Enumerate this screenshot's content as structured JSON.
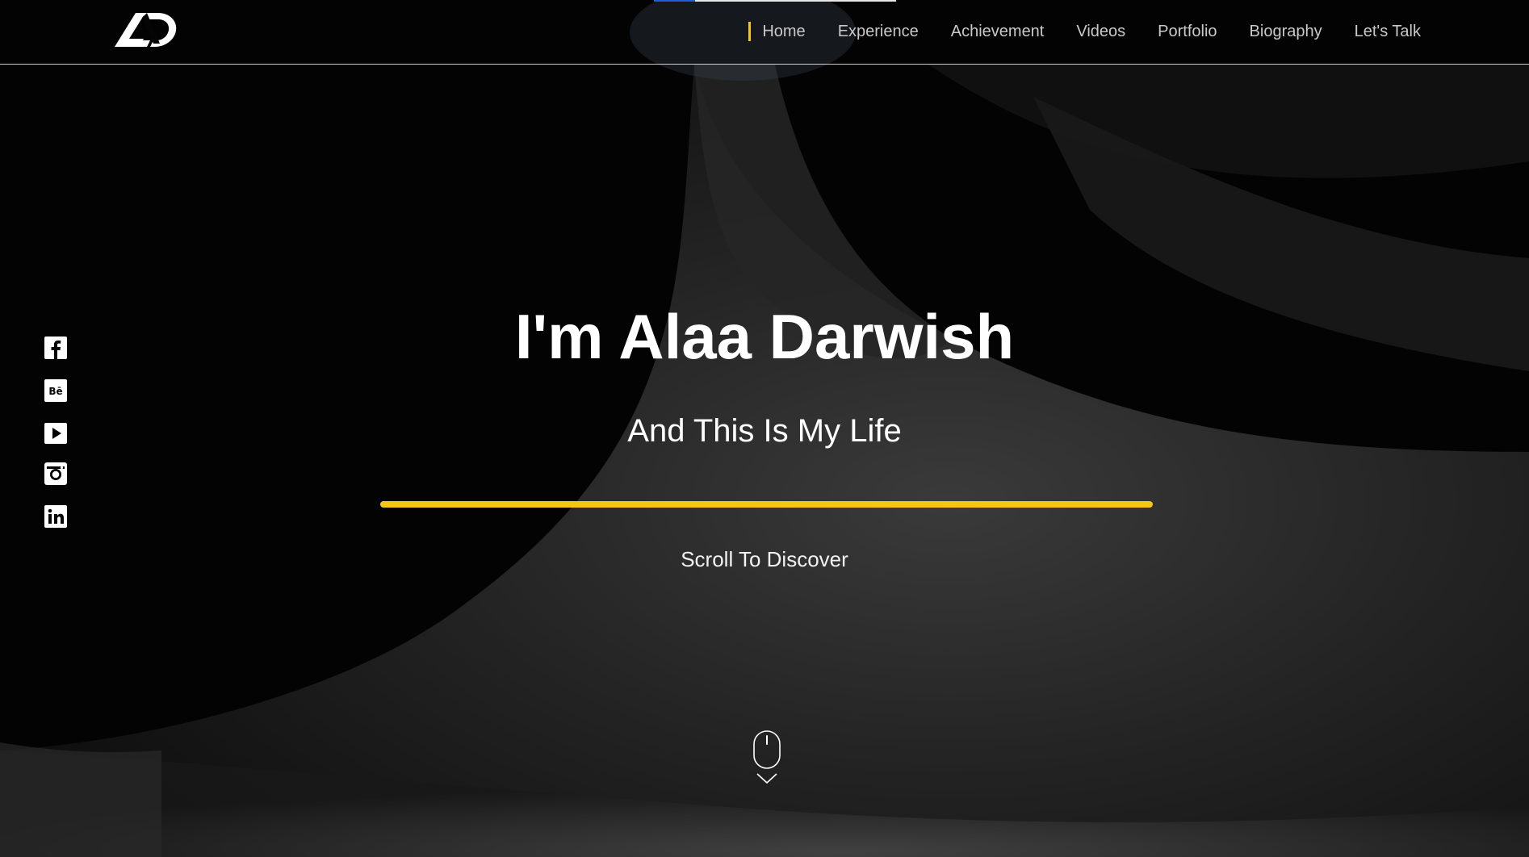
{
  "header": {
    "logo": {
      "icon": "ad-monogram-logo",
      "color": "#ffffff"
    },
    "scroll_progress": 0.17,
    "nav": [
      {
        "label": "Home",
        "active": true
      },
      {
        "label": "Experience",
        "active": false
      },
      {
        "label": "Achievement",
        "active": false
      },
      {
        "label": "Videos",
        "active": false
      },
      {
        "label": "Portfolio",
        "active": false
      },
      {
        "label": "Biography",
        "active": false
      },
      {
        "label": "Let's Talk",
        "active": false
      }
    ]
  },
  "social": [
    {
      "icon": "facebook-icon"
    },
    {
      "icon": "behance-icon"
    },
    {
      "icon": "youtube-icon"
    },
    {
      "icon": "instagram-icon"
    },
    {
      "icon": "linkedin-icon"
    }
  ],
  "hero": {
    "title": "I'm Alaa Darwish",
    "subtitle": "And This Is My Life",
    "scroll_label": "Scroll To Discover",
    "scroll_icon": "mouse-scroll-icon"
  },
  "colors": {
    "accent": "#f5c518",
    "progress": "#1e5fd6",
    "background": "#050505",
    "text": "#ffffff",
    "nav_text": "#c9c9c9"
  }
}
